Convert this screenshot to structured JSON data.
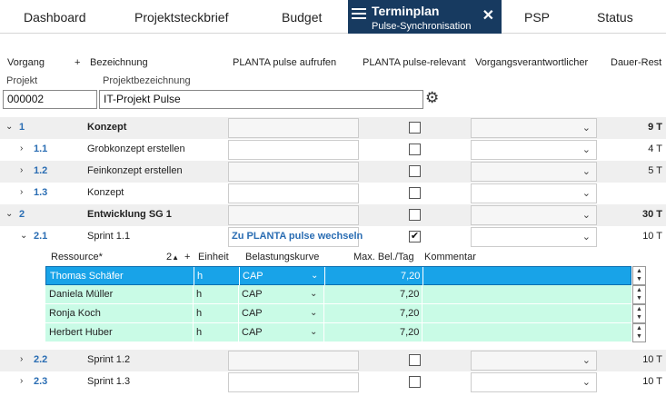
{
  "tabs": [
    {
      "label": "Dashboard"
    },
    {
      "label": "Projektsteckbrief"
    },
    {
      "label": "Budget"
    },
    {
      "label": "Terminplan",
      "sublabel": "Pulse-Synchronisation",
      "active": true
    },
    {
      "label": "PSP"
    },
    {
      "label": "Status"
    }
  ],
  "columns": {
    "vorgang": "Vorgang",
    "plus": "+",
    "bezeichnung": "Bezeichnung",
    "pulse_aufrufen": "PLANTA pulse aufrufen",
    "pulse_relevant": "PLANTA pulse-relevant",
    "verantwortlicher": "Vorgangsverantwortlicher",
    "dauer_rest": "Dauer-Rest"
  },
  "project": {
    "projekt_label": "Projekt",
    "projektbezeichnung_label": "Projektbezeichnung",
    "projekt_value": "000002",
    "projektbezeichnung_value": "IT-Projekt Pulse"
  },
  "rows": [
    {
      "id": "1",
      "name": "Konzept",
      "bold": true,
      "checked": false,
      "dauer": "9 T",
      "shaded": true,
      "expanded": true
    },
    {
      "id": "1.1",
      "name": "Grobkonzept erstellen",
      "bold": false,
      "checked": false,
      "dauer": "4 T",
      "shaded": false,
      "expanded": false
    },
    {
      "id": "1.2",
      "name": "Feinkonzept erstellen",
      "bold": false,
      "checked": false,
      "dauer": "5 T",
      "shaded": true,
      "expanded": false
    },
    {
      "id": "1.3",
      "name": "Konzept",
      "bold": false,
      "checked": false,
      "dauer": "",
      "shaded": false,
      "expanded": false
    },
    {
      "id": "2",
      "name": "Entwicklung SG 1",
      "bold": true,
      "checked": false,
      "dauer": "30 T",
      "shaded": true,
      "expanded": true
    },
    {
      "id": "2.1",
      "name": "Sprint 1.1",
      "bold": false,
      "checked": true,
      "dauer": "10 T",
      "shaded": false,
      "expanded": true,
      "link": "Zu PLANTA pulse wechseln"
    },
    {
      "id": "2.2",
      "name": "Sprint 1.2",
      "bold": false,
      "checked": false,
      "dauer": "10 T",
      "shaded": true,
      "expanded": false
    },
    {
      "id": "2.3",
      "name": "Sprint 1.3",
      "bold": false,
      "checked": false,
      "dauer": "10 T",
      "shaded": false,
      "expanded": false
    }
  ],
  "check_mark": "✔",
  "resources": {
    "headers": {
      "ressource": "Ressource*",
      "sort": "2",
      "plus": "+",
      "einheit": "Einheit",
      "belastungskurve": "Belastungskurve",
      "max_bel": "Max. Bel./Tag",
      "kommentar": "Kommentar"
    },
    "rows": [
      {
        "name": "Thomas Schäfer",
        "einheit": "h",
        "kurve": "CAP",
        "max": "7,20",
        "selected": true
      },
      {
        "name": "Daniela Müller",
        "einheit": "h",
        "kurve": "CAP",
        "max": "7,20",
        "selected": false
      },
      {
        "name": "Ronja Koch",
        "einheit": "h",
        "kurve": "CAP",
        "max": "7,20",
        "selected": false
      },
      {
        "name": "Herbert Huber",
        "einheit": "h",
        "kurve": "CAP",
        "max": "7,20",
        "selected": false
      }
    ]
  },
  "icons": {
    "close": "✕",
    "chevron_right": "›",
    "chevron_down": "⌄",
    "dropdown": "⌄",
    "gear": "⚙",
    "sort_up": "▲",
    "spin_up": "▲",
    "spin_down": "▼"
  },
  "colors": {
    "active_tab": "#173a60",
    "link": "#2a6db3",
    "resource_row": "#c9fbe6",
    "selected_row": "#18a3e8"
  }
}
